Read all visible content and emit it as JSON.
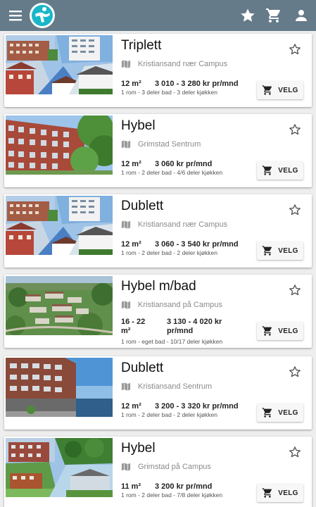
{
  "appbar": {
    "background": "#657b8a",
    "icons": [
      "menu-icon",
      "app-logo",
      "favorites-star-icon",
      "cart-icon",
      "account-icon"
    ]
  },
  "listings": [
    {
      "title": "Triplett",
      "location": "Kristiansand nær Campus",
      "size": "12 m²",
      "price": "3 010 - 3 280 kr pr/mnd",
      "details": "1 rom - 3 deler bad - 3 deler kjøkken",
      "button": "VELG",
      "image": "collage-campus-buildings"
    },
    {
      "title": "Hybel",
      "location": "Grimstad Sentrum",
      "size": "12 m²",
      "price": "3 060 kr pr/mnd",
      "details": "1 rom - 2 deler bad - 4/6 deler kjøkken",
      "button": "VELG",
      "image": "red-apartment-block"
    },
    {
      "title": "Dublett",
      "location": "Kristiansand nær Campus",
      "size": "12 m²",
      "price": "3 060 - 3 540 kr pr/mnd",
      "details": "1 rom - 2 deler bad - 2 deler kjøkken",
      "button": "VELG",
      "image": "collage-campus-buildings"
    },
    {
      "title": "Hybel m/bad",
      "location": "Kristiansand på Campus",
      "size": "16 - 22 m²",
      "price": "3 130 - 4 020 kr pr/mnd",
      "details": "1 rom - eget bad - 10/17 deler kjøkken",
      "button": "VELG",
      "image": "aerial-campus-view"
    },
    {
      "title": "Dublett",
      "location": "Kristiansand Sentrum",
      "size": "12 m²",
      "price": "3 200 - 3 320 kr pr/mnd",
      "details": "1 rom - 2 deler bad - 2 deler kjøkken",
      "button": "VELG",
      "image": "brick-building-waterfront"
    },
    {
      "title": "Hybel",
      "location": "Grimstad på Campus",
      "size": "11 m²",
      "price": "3 200 kr pr/mnd",
      "details": "1 rom - 2 deler bad - 7/8 deler kjøkken",
      "button": "VELG",
      "image": "collage-green-campus"
    }
  ]
}
